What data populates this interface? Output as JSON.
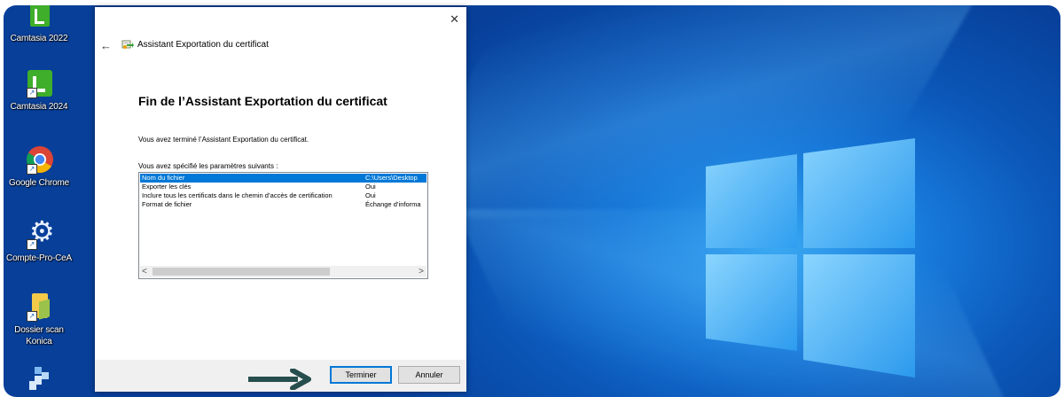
{
  "desktop": {
    "icons": [
      {
        "label": "Camtasia 2022",
        "icon": "camtasia-icon"
      },
      {
        "label": "Camtasia 2024",
        "icon": "camtasia-icon"
      },
      {
        "label": "Google Chrome",
        "icon": "chrome-icon"
      },
      {
        "label": "Compte-Pro-CeA",
        "icon": "gear-icon"
      },
      {
        "label": "Dossier scan",
        "label2": "Konica",
        "icon": "folder-icon"
      },
      {
        "label": "",
        "icon": "app-icon"
      }
    ],
    "wallpaper": "windows-10-logo"
  },
  "dialog": {
    "title": "Assistant Exportation du certificat",
    "heading": "Fin de l’Assistant Exportation du certificat",
    "completed_text": "Vous avez terminé l’Assistant Exportation du certificat.",
    "params_label": "Vous avez spécifié les paramètres suivants :",
    "params": [
      {
        "name": "Nom du fichier",
        "value": "C:\\Users\\Desktop",
        "selected": true
      },
      {
        "name": "Exporter les clés",
        "value": "Oui",
        "selected": false
      },
      {
        "name": "Inclure tous les certificats dans le chemin d’accès de certification",
        "value": "Oui",
        "selected": false
      },
      {
        "name": "Format de fichier",
        "value": "Échange d’informa",
        "selected": false
      }
    ],
    "scroll_left": "<",
    "scroll_right": ">",
    "buttons": {
      "finish": "Terminer",
      "cancel": "Annuler"
    },
    "close_glyph": "✕",
    "back_glyph": "←"
  },
  "colors": {
    "selection": "#0078d7",
    "annotation_arrow": "#264e4d",
    "wallpaper_blue": "#0b57b8"
  }
}
